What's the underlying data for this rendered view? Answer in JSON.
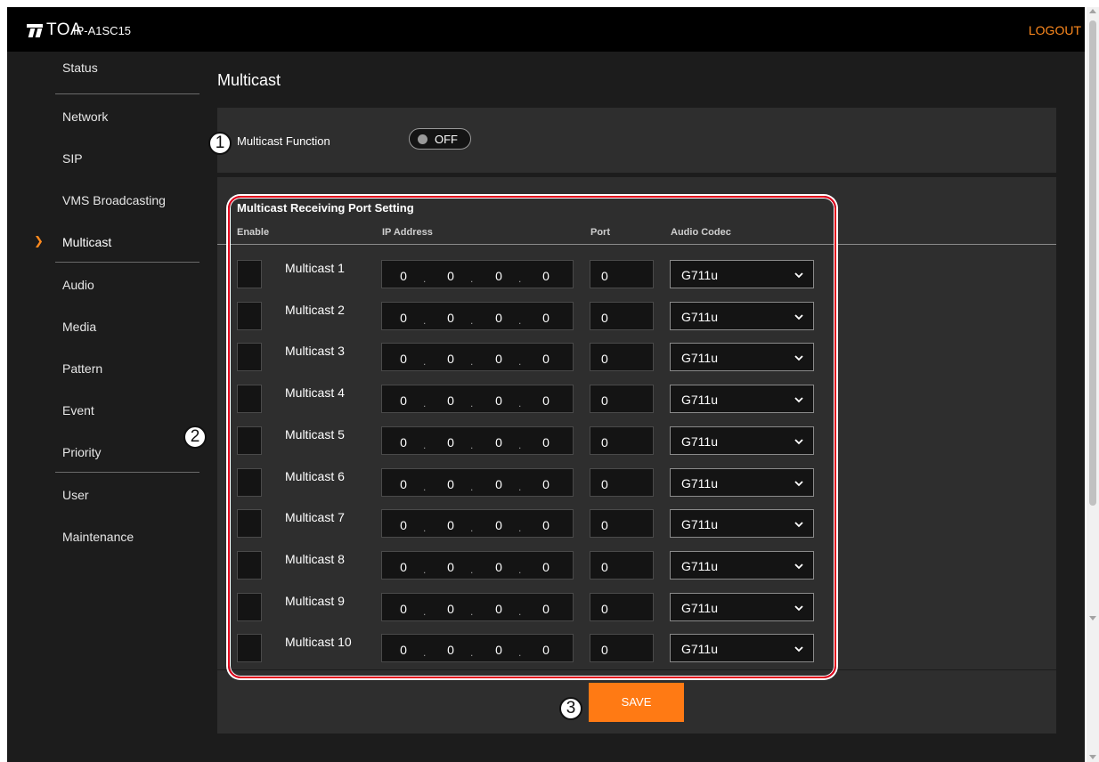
{
  "header": {
    "brand": "TOA",
    "model": "IP-A1SC15",
    "logout_label": "LOGOUT"
  },
  "sidebar": {
    "items": [
      {
        "label": "Status"
      },
      {
        "label": "Network"
      },
      {
        "label": "SIP"
      },
      {
        "label": "VMS Broadcasting"
      },
      {
        "label": "Multicast",
        "active": true
      },
      {
        "label": "Audio"
      },
      {
        "label": "Media"
      },
      {
        "label": "Pattern"
      },
      {
        "label": "Event"
      },
      {
        "label": "Priority"
      },
      {
        "label": "User"
      },
      {
        "label": "Maintenance"
      }
    ]
  },
  "page": {
    "title": "Multicast"
  },
  "multicast_function": {
    "label": "Multicast Function",
    "state": "OFF"
  },
  "receiving_ports": {
    "title": "Multicast Receiving Port Setting",
    "columns": {
      "enable": "Enable",
      "ip": "IP Address",
      "port": "Port",
      "codec": "Audio Codec"
    },
    "rows": [
      {
        "label": "Multicast 1",
        "ip": [
          "0",
          "0",
          "0",
          "0"
        ],
        "port": "0",
        "codec": "G711u",
        "enabled": false
      },
      {
        "label": "Multicast 2",
        "ip": [
          "0",
          "0",
          "0",
          "0"
        ],
        "port": "0",
        "codec": "G711u",
        "enabled": false
      },
      {
        "label": "Multicast 3",
        "ip": [
          "0",
          "0",
          "0",
          "0"
        ],
        "port": "0",
        "codec": "G711u",
        "enabled": false
      },
      {
        "label": "Multicast 4",
        "ip": [
          "0",
          "0",
          "0",
          "0"
        ],
        "port": "0",
        "codec": "G711u",
        "enabled": false
      },
      {
        "label": "Multicast 5",
        "ip": [
          "0",
          "0",
          "0",
          "0"
        ],
        "port": "0",
        "codec": "G711u",
        "enabled": false
      },
      {
        "label": "Multicast 6",
        "ip": [
          "0",
          "0",
          "0",
          "0"
        ],
        "port": "0",
        "codec": "G711u",
        "enabled": false
      },
      {
        "label": "Multicast 7",
        "ip": [
          "0",
          "0",
          "0",
          "0"
        ],
        "port": "0",
        "codec": "G711u",
        "enabled": false
      },
      {
        "label": "Multicast 8",
        "ip": [
          "0",
          "0",
          "0",
          "0"
        ],
        "port": "0",
        "codec": "G711u",
        "enabled": false
      },
      {
        "label": "Multicast 9",
        "ip": [
          "0",
          "0",
          "0",
          "0"
        ],
        "port": "0",
        "codec": "G711u",
        "enabled": false
      },
      {
        "label": "Multicast 10",
        "ip": [
          "0",
          "0",
          "0",
          "0"
        ],
        "port": "0",
        "codec": "G711u",
        "enabled": false
      }
    ]
  },
  "save_label": "SAVE",
  "callouts": [
    "1",
    "2",
    "3"
  ],
  "colors": {
    "accent": "#ff7a14",
    "callout_border": "#e2001a",
    "background": "#1c1c1c",
    "panel": "#2e2e2e"
  }
}
